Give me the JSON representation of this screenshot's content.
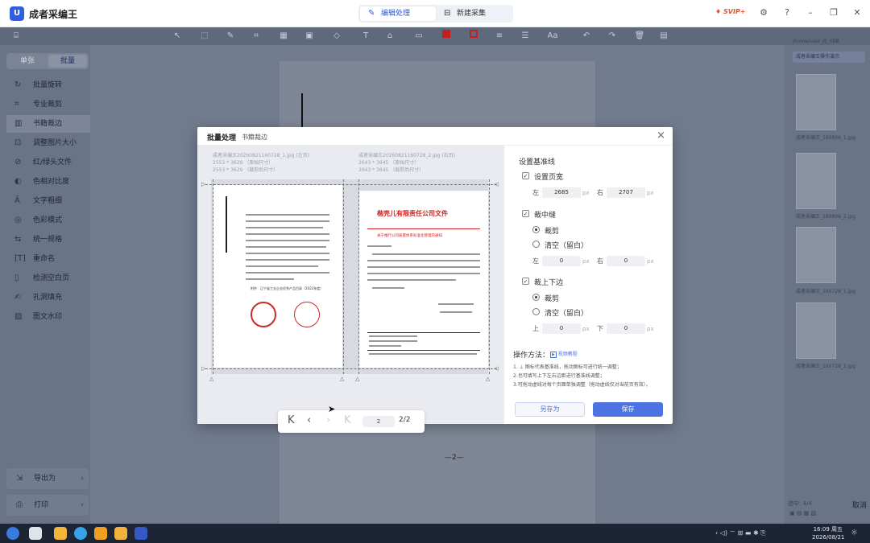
{
  "app": {
    "name": "成者采编王",
    "logo_letter": "U"
  },
  "tabs": [
    {
      "label": "编辑处理",
      "active": true
    },
    {
      "label": "新建采集",
      "active": false
    }
  ],
  "header": {
    "svip": "SVIP+"
  },
  "sidebar": {
    "mode_single": "单张",
    "mode_batch": "批量",
    "items": [
      {
        "label": "批量旋转"
      },
      {
        "label": "专业裁剪"
      },
      {
        "label": "书籍裁边",
        "active": true
      },
      {
        "label": "调整图片大小"
      },
      {
        "label": "红/绿头文件"
      },
      {
        "label": "色相对比度"
      },
      {
        "label": "文字粗细"
      },
      {
        "label": "色彩模式"
      },
      {
        "label": "统一规格"
      },
      {
        "label": "重命名"
      },
      {
        "label": "检测空白页"
      },
      {
        "label": "孔洞填充"
      },
      {
        "label": "图文水印"
      }
    ],
    "export_label": "导出为",
    "print_label": "打印"
  },
  "right_panel": {
    "path": "/home/user_dj_扫描",
    "filter": "成者采编王操作演示",
    "thumbs": [
      {
        "label": "成者采编王_160606_1.jpg"
      },
      {
        "label": "成者采编王_160606_2.jpg"
      },
      {
        "label": "成者采编王_160728_1.jpg"
      },
      {
        "label": "成者采编王_160728_2.jpg"
      }
    ],
    "count": "选中: 4/4",
    "cancel": "取消"
  },
  "page_number": "—2—",
  "dialog": {
    "title": "批量处理",
    "subtitle": "书籍裁边",
    "left_file": {
      "name": "成者采编王20260821160728_1.jpg (左页)",
      "orig": "2553 * 3629 （原始尺寸）",
      "cropped": "2553 * 3629 （裁剪后尺寸）"
    },
    "right_file": {
      "name": "成者采编王20260821160728_2.jpg (右页)",
      "orig": "2643 * 3645 （原始尺寸）",
      "cropped": "2643 * 3645 （裁剪后尺寸）"
    },
    "doc_right_title": "楷壳儿有限责任公司文件",
    "doc_right_subtitle": "关于推行公司质量体系标准化管理的通知",
    "doc_left_caption": "附件：辽宁省工业企业优秀产品目录（2022年度）",
    "pager": {
      "current": "2",
      "total": "2/2"
    },
    "settings": {
      "title": "设置基准线",
      "set_width": "设置页宽",
      "left_label": "左",
      "left_value": "2685",
      "right_label": "右",
      "right_value": "2707",
      "unit": "px",
      "mid_label": "裁中缝",
      "crop_label": "裁剪",
      "clear_label": "清空（留白）",
      "mid_left": "0",
      "mid_right": "0",
      "tb_label": "裁上下边",
      "top_label": "上",
      "top_value": "0",
      "bottom_label": "下",
      "bottom_value": "0",
      "method_label": "操作方法：",
      "video_label": "视频教程",
      "tips": [
        "1. ⊥ 图标代表基准线，拖动图标可进行统一调整；",
        "2.也可填写上下左右边距进行基准线调整；",
        "3.可拖动虚线对每个页面单独调整（拖动虚线仅对当前页有效）。"
      ],
      "save_as": "另存为",
      "save": "保存"
    }
  },
  "taskbar": {
    "time": "16:09 周五",
    "date": "2026/08/21"
  }
}
